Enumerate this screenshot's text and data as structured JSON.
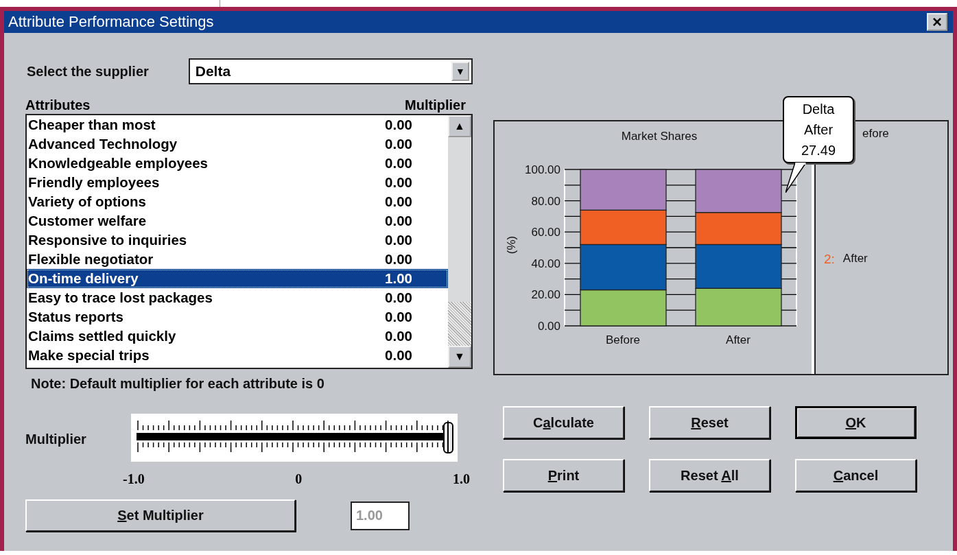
{
  "window": {
    "title": "Attribute Performance Settings",
    "close": "×"
  },
  "supplier": {
    "label": "Select the supplier",
    "value": "Delta",
    "arrow": "▼"
  },
  "attributes": {
    "header_name": "Attributes",
    "header_value": "Multiplier",
    "rows": [
      {
        "name": "Cheaper than most",
        "value": "0.00",
        "selected": false
      },
      {
        "name": "Advanced Technology",
        "value": "0.00",
        "selected": false
      },
      {
        "name": "Knowledgeable employees",
        "value": "0.00",
        "selected": false
      },
      {
        "name": "Friendly employees",
        "value": "0.00",
        "selected": false
      },
      {
        "name": "Variety of options",
        "value": "0.00",
        "selected": false
      },
      {
        "name": "Customer welfare",
        "value": "0.00",
        "selected": false
      },
      {
        "name": "Responsive to inquiries",
        "value": "0.00",
        "selected": false
      },
      {
        "name": "Flexible negotiator",
        "value": "0.00",
        "selected": false
      },
      {
        "name": "On-time delivery",
        "value": "1.00",
        "selected": true
      },
      {
        "name": "Easy to trace lost packages",
        "value": "0.00",
        "selected": false
      },
      {
        "name": "Status reports",
        "value": "0.00",
        "selected": false
      },
      {
        "name": "Claims settled quickly",
        "value": "0.00",
        "selected": false
      },
      {
        "name": "Make special trips",
        "value": "0.00",
        "selected": false
      }
    ],
    "scroll_up": "▲",
    "scroll_down": "▼"
  },
  "note": "Note: Default multiplier for each attribute is 0",
  "slider": {
    "label": "Multiplier",
    "level": 1,
    "min_label": "-1.0",
    "mid_label": "0",
    "max_label": "1.0"
  },
  "set_button": {
    "key": "S",
    "after": "et Multiplier"
  },
  "multiplier_field": {
    "value": "1.00",
    "disabled": true
  },
  "chart": {
    "chart_data": {
      "type": "bar",
      "title": "Market Shares",
      "ylabel": "(%)",
      "categories": [
        "Before",
        "After"
      ],
      "stacked": true,
      "grid": true,
      "ylim": [
        0,
        100
      ],
      "yticks": [
        {
          "value": 0,
          "label": "0.00"
        },
        {
          "value": 20,
          "label": "20.00"
        },
        {
          "value": 40,
          "label": "40.00"
        },
        {
          "value": 60,
          "label": "60.00"
        },
        {
          "value": 80,
          "label": "80.00"
        },
        {
          "value": 100,
          "label": "100.00"
        }
      ],
      "series": [
        {
          "color": "#92c562",
          "values": [
            23,
            24
          ]
        },
        {
          "color": "#0a5aa8",
          "values": [
            29,
            28
          ]
        },
        {
          "color": "#f06024",
          "values": [
            22,
            20.5
          ]
        },
        {
          "color": "#a882ba",
          "values": [
            26,
            27.5
          ]
        }
      ]
    },
    "tooltip": [
      "Delta",
      "After",
      "27.49"
    ],
    "legend": [
      {
        "label": "efore"
      },
      {
        "number": "2:",
        "label": "After",
        "color": "#f06024"
      }
    ]
  },
  "buttons": [
    {
      "before": "C",
      "key": "a",
      "after": "lculate",
      "default": false
    },
    {
      "key": "R",
      "after": "eset",
      "default": false
    },
    {
      "key": "O",
      "after": "K",
      "default": true
    },
    {
      "key": "P",
      "after": "rint",
      "default": false
    },
    {
      "before": "Reset ",
      "key": "A",
      "after": "ll",
      "default": false
    },
    {
      "key": "C",
      "after": "ancel",
      "default": false
    }
  ]
}
